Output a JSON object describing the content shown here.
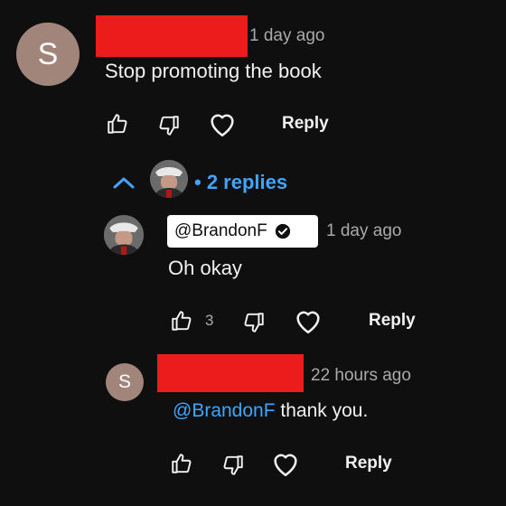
{
  "comment": {
    "avatar_letter": "S",
    "time": "1 day ago",
    "text": "Stop promoting the book",
    "reply_label": "Reply"
  },
  "replies_toggle": {
    "label": "• 2 replies",
    "accent": "#3ea6ff"
  },
  "reply1": {
    "author": "@BrandonF",
    "time": "1 day ago",
    "text": "Oh okay",
    "likes": "3",
    "reply_label": "Reply"
  },
  "reply2": {
    "avatar_letter": "S",
    "time": "22 hours ago",
    "mention": "@BrandonF",
    "text": " thank you.",
    "reply_label": "Reply"
  },
  "colors": {
    "background": "#0f0f0f",
    "redaction": "#ea1c1c",
    "avatar": "#a1857b",
    "link": "#3ea6ff"
  }
}
